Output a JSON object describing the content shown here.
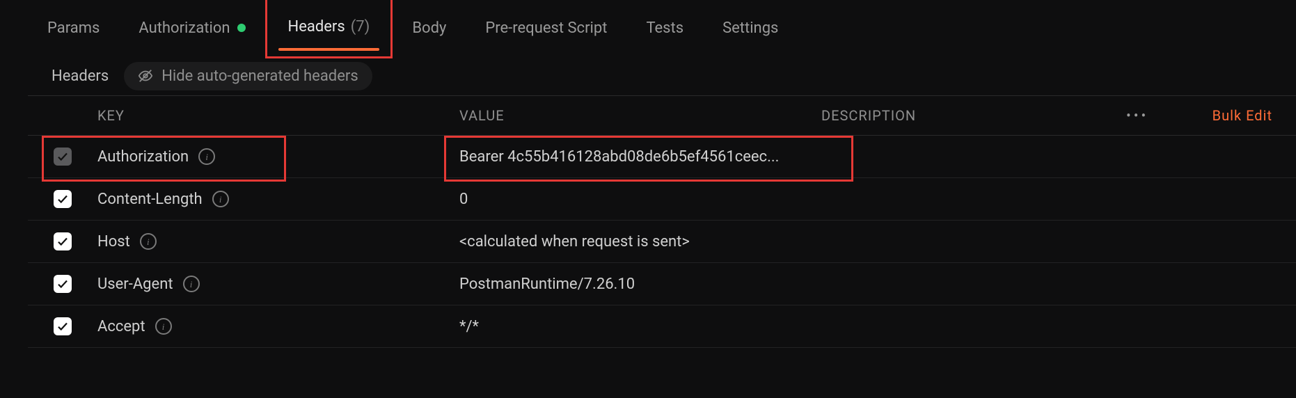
{
  "tabs": {
    "params": "Params",
    "authorization": "Authorization",
    "headers": "Headers",
    "headers_count": "(7)",
    "body": "Body",
    "prerequest": "Pre-request Script",
    "tests": "Tests",
    "settings": "Settings"
  },
  "subbar": {
    "title": "Headers",
    "hide_label": "Hide auto-generated headers"
  },
  "columns": {
    "key": "KEY",
    "value": "VALUE",
    "description": "DESCRIPTION",
    "bulk_edit": "Bulk Edit",
    "more": "•••"
  },
  "rows": [
    {
      "key": "Authorization",
      "value": "Bearer 4c55b416128abd08de6b5ef4561ceec...",
      "dim": true
    },
    {
      "key": "Content-Length",
      "value": "0",
      "dim": false
    },
    {
      "key": "Host",
      "value": "<calculated when request is sent>",
      "dim": false
    },
    {
      "key": "User-Agent",
      "value": "PostmanRuntime/7.26.10",
      "dim": false
    },
    {
      "key": "Accept",
      "value": "*/*",
      "dim": false
    }
  ]
}
